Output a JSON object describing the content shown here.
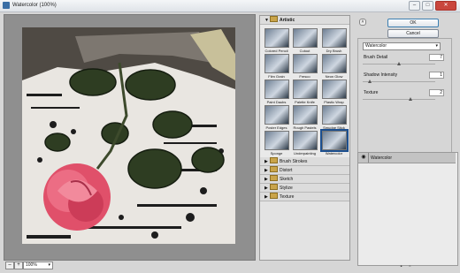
{
  "window": {
    "title": "Watercolor (100%)",
    "minimize": "–",
    "maximize": "□",
    "close": "✕"
  },
  "preview": {
    "zoom_out": "–",
    "zoom_in": "+",
    "zoom_value": "100%",
    "zoom_arrow": "▾"
  },
  "gallery": {
    "open_category": "Artistic",
    "filters": [
      {
        "label": "Colored Pencil"
      },
      {
        "label": "Cutout"
      },
      {
        "label": "Dry Brush"
      },
      {
        "label": "Film Grain"
      },
      {
        "label": "Fresco"
      },
      {
        "label": "Neon Glow"
      },
      {
        "label": "Paint Daubs"
      },
      {
        "label": "Palette Knife"
      },
      {
        "label": "Plastic Wrap"
      },
      {
        "label": "Poster Edges"
      },
      {
        "label": "Rough Pastels"
      },
      {
        "label": "Smudge Stick"
      },
      {
        "label": "Sponge"
      },
      {
        "label": "Underpainting"
      },
      {
        "label": "Watercolor"
      }
    ],
    "categories": [
      "Brush Strokes",
      "Distort",
      "Sketch",
      "Stylize",
      "Texture"
    ]
  },
  "dialog": {
    "ok": "OK",
    "cancel": "Cancel",
    "collapse_glyph": "˄",
    "filter_select": "Watercolor",
    "select_arrow": "▾"
  },
  "params": [
    {
      "label": "Brush Detail",
      "value": "7",
      "level": 0.5
    },
    {
      "label": "Shadow Intensity",
      "value": "1",
      "level": 0.1
    },
    {
      "label": "Texture",
      "value": "2",
      "level": 0.66
    }
  ],
  "layers": {
    "active": "Watercolor",
    "eye_glyph": "◉",
    "new_glyph": "▪",
    "delete_glyph": "▫"
  }
}
